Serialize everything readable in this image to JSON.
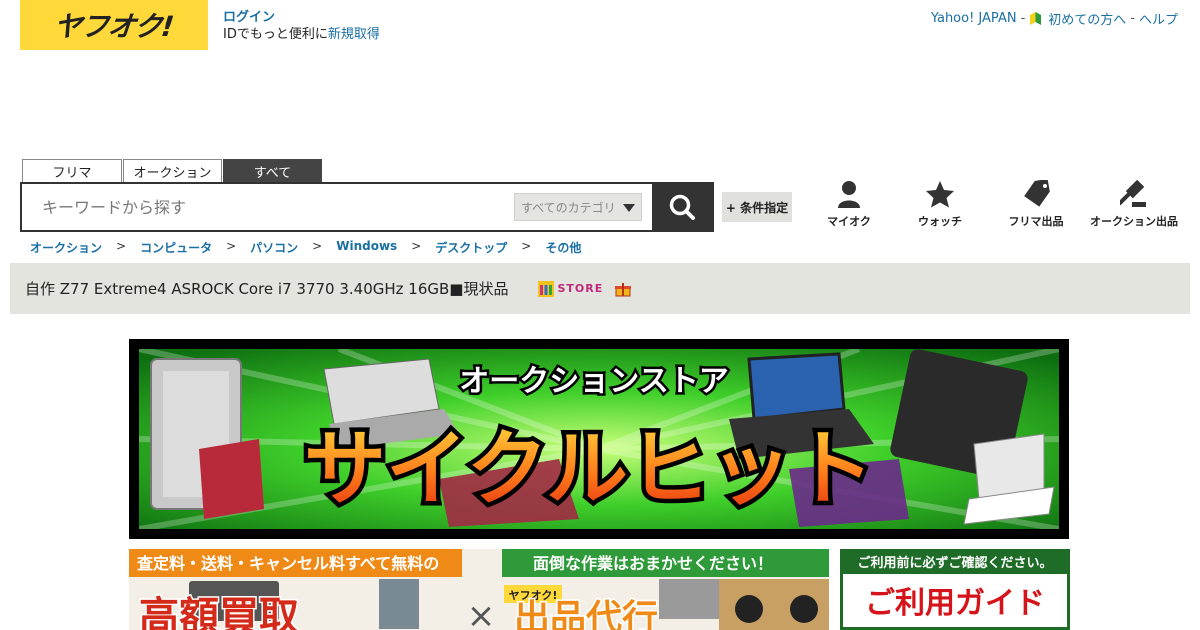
{
  "header": {
    "logo_text": "ヤフオク!",
    "login_label": "ログイン",
    "login_note": "IDでもっと便利に",
    "register_label": "新規取得",
    "top_links": [
      {
        "label": "Yahoo! JAPAN"
      },
      {
        "label": "初めての方へ"
      },
      {
        "label": "ヘルプ"
      }
    ],
    "separator": "-"
  },
  "search": {
    "tabs": [
      {
        "label": "フリマ",
        "active": false
      },
      {
        "label": "オークション",
        "active": false
      },
      {
        "label": "すべて",
        "active": true
      }
    ],
    "placeholder": "キーワードから探す",
    "category_value": "すべてのカテゴリ",
    "condition_button": "+ 条件指定"
  },
  "icon_nav": [
    {
      "label": "マイオク",
      "icon": "user-icon"
    },
    {
      "label": "ウォッチ",
      "icon": "star-icon"
    },
    {
      "label": "フリマ出品",
      "icon": "tag-icon"
    },
    {
      "label": "オークション出品",
      "icon": "gavel-icon"
    }
  ],
  "breadcrumb": [
    "オークション",
    "コンピュータ",
    "パソコン",
    "Windows",
    "デスクトップ",
    "その他"
  ],
  "breadcrumb_sep": ">",
  "item": {
    "title": "自作 Z77 Extreme4 ASROCK Core i7 3770 3.40GHz 16GB■現状品",
    "store_label": "STORE"
  },
  "banner": {
    "subtitle": "オークションストア",
    "title": "サイクルヒット"
  },
  "sub_banners": {
    "left_top": "査定料・送料・キャンセル料すべて無料の",
    "left_top_right": "面倒な作業はおまかせください！",
    "left_big": "高額買取",
    "left_logo": "ヤフオク!",
    "left_big_right": "出品代行",
    "right_top": "ご利用前に必ずご確認ください。",
    "right_big": "ご利用ガイド"
  },
  "colors": {
    "logo_bg": "#ffd83a",
    "link": "#1a6fa5",
    "dark": "#333333",
    "titlebar_bg": "#e4e4df",
    "banner_green": "#3fcf2a"
  }
}
